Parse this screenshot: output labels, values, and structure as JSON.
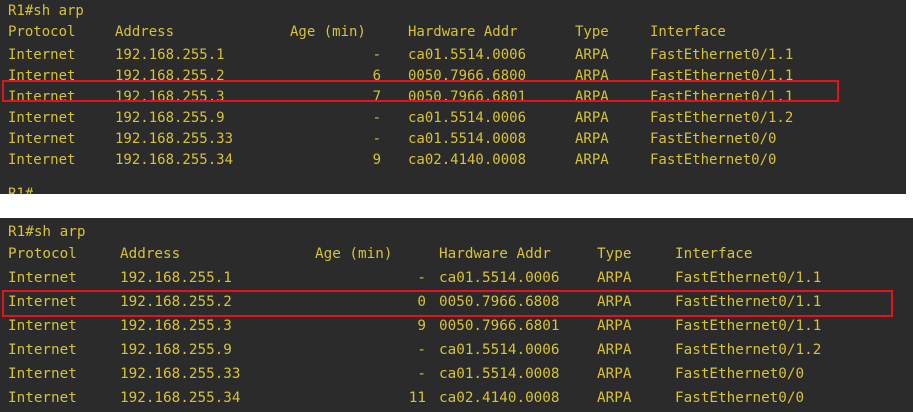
{
  "top": {
    "prompt": "R1#sh arp",
    "headers": {
      "protocol": "Protocol",
      "address": "Address",
      "age": "Age (min)",
      "hw": "Hardware Addr",
      "type": "Type",
      "iface": "Interface"
    },
    "rows": [
      {
        "protocol": "Internet",
        "address": "192.168.255.1",
        "age": "-",
        "hw": "ca01.5514.0006",
        "type": "ARPA",
        "iface": "FastEthernet0/1.1"
      },
      {
        "protocol": "Internet",
        "address": "192.168.255.2",
        "age": "6",
        "hw": "0050.7966.6800",
        "type": "ARPA",
        "iface": "FastEthernet0/1.1"
      },
      {
        "protocol": "Internet",
        "address": "192.168.255.3",
        "age": "7",
        "hw": "0050.7966.6801",
        "type": "ARPA",
        "iface": "FastEthernet0/1.1"
      },
      {
        "protocol": "Internet",
        "address": "192.168.255.9",
        "age": "-",
        "hw": "ca01.5514.0006",
        "type": "ARPA",
        "iface": "FastEthernet0/1.2"
      },
      {
        "protocol": "Internet",
        "address": "192.168.255.33",
        "age": "-",
        "hw": "ca01.5514.0008",
        "type": "ARPA",
        "iface": "FastEthernet0/0"
      },
      {
        "protocol": "Internet",
        "address": "192.168.255.34",
        "age": "9",
        "hw": "ca02.4140.0008",
        "type": "ARPA",
        "iface": "FastEthernet0/0"
      }
    ],
    "trailing_prompt": "R1#"
  },
  "bottom": {
    "prompt": "R1#sh arp",
    "headers": {
      "protocol": "Protocol",
      "address": "Address",
      "age": "Age (min)",
      "hw": "Hardware Addr",
      "type": "Type",
      "iface": "Interface"
    },
    "rows": [
      {
        "protocol": "Internet",
        "address": "192.168.255.1",
        "age": "-",
        "hw": "ca01.5514.0006",
        "type": "ARPA",
        "iface": "FastEthernet0/1.1"
      },
      {
        "protocol": "Internet",
        "address": "192.168.255.2",
        "age": "0",
        "hw": "0050.7966.6808",
        "type": "ARPA",
        "iface": "FastEthernet0/1.1"
      },
      {
        "protocol": "Internet",
        "address": "192.168.255.3",
        "age": "9",
        "hw": "0050.7966.6801",
        "type": "ARPA",
        "iface": "FastEthernet0/1.1"
      },
      {
        "protocol": "Internet",
        "address": "192.168.255.9",
        "age": "-",
        "hw": "ca01.5514.0006",
        "type": "ARPA",
        "iface": "FastEthernet0/1.2"
      },
      {
        "protocol": "Internet",
        "address": "192.168.255.33",
        "age": "-",
        "hw": "ca01.5514.0008",
        "type": "ARPA",
        "iface": "FastEthernet0/0"
      },
      {
        "protocol": "Internet",
        "address": "192.168.255.34",
        "age": "11",
        "hw": "ca02.4140.0008",
        "type": "ARPA",
        "iface": "FastEthernet0/0"
      }
    ]
  },
  "colors": {
    "background": "#2b2b2b",
    "text": "#d6c23c",
    "highlight_border": "#e3121b"
  }
}
